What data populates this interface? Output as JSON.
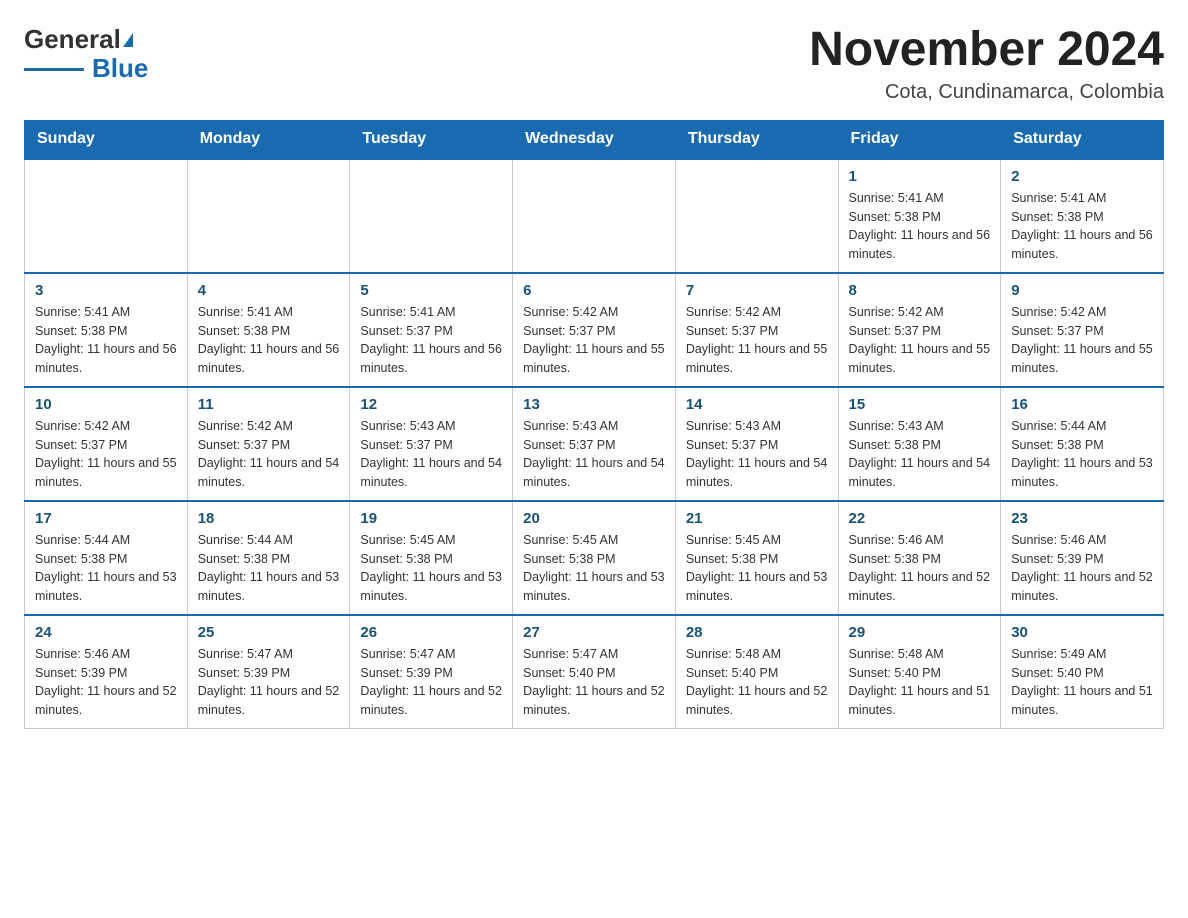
{
  "header": {
    "logo_general": "General",
    "logo_blue": "Blue",
    "month_title": "November 2024",
    "location": "Cota, Cundinamarca, Colombia"
  },
  "weekdays": [
    "Sunday",
    "Monday",
    "Tuesday",
    "Wednesday",
    "Thursday",
    "Friday",
    "Saturday"
  ],
  "weeks": [
    [
      {
        "day": "",
        "info": ""
      },
      {
        "day": "",
        "info": ""
      },
      {
        "day": "",
        "info": ""
      },
      {
        "day": "",
        "info": ""
      },
      {
        "day": "",
        "info": ""
      },
      {
        "day": "1",
        "info": "Sunrise: 5:41 AM\nSunset: 5:38 PM\nDaylight: 11 hours and 56 minutes."
      },
      {
        "day": "2",
        "info": "Sunrise: 5:41 AM\nSunset: 5:38 PM\nDaylight: 11 hours and 56 minutes."
      }
    ],
    [
      {
        "day": "3",
        "info": "Sunrise: 5:41 AM\nSunset: 5:38 PM\nDaylight: 11 hours and 56 minutes."
      },
      {
        "day": "4",
        "info": "Sunrise: 5:41 AM\nSunset: 5:38 PM\nDaylight: 11 hours and 56 minutes."
      },
      {
        "day": "5",
        "info": "Sunrise: 5:41 AM\nSunset: 5:37 PM\nDaylight: 11 hours and 56 minutes."
      },
      {
        "day": "6",
        "info": "Sunrise: 5:42 AM\nSunset: 5:37 PM\nDaylight: 11 hours and 55 minutes."
      },
      {
        "day": "7",
        "info": "Sunrise: 5:42 AM\nSunset: 5:37 PM\nDaylight: 11 hours and 55 minutes."
      },
      {
        "day": "8",
        "info": "Sunrise: 5:42 AM\nSunset: 5:37 PM\nDaylight: 11 hours and 55 minutes."
      },
      {
        "day": "9",
        "info": "Sunrise: 5:42 AM\nSunset: 5:37 PM\nDaylight: 11 hours and 55 minutes."
      }
    ],
    [
      {
        "day": "10",
        "info": "Sunrise: 5:42 AM\nSunset: 5:37 PM\nDaylight: 11 hours and 55 minutes."
      },
      {
        "day": "11",
        "info": "Sunrise: 5:42 AM\nSunset: 5:37 PM\nDaylight: 11 hours and 54 minutes."
      },
      {
        "day": "12",
        "info": "Sunrise: 5:43 AM\nSunset: 5:37 PM\nDaylight: 11 hours and 54 minutes."
      },
      {
        "day": "13",
        "info": "Sunrise: 5:43 AM\nSunset: 5:37 PM\nDaylight: 11 hours and 54 minutes."
      },
      {
        "day": "14",
        "info": "Sunrise: 5:43 AM\nSunset: 5:37 PM\nDaylight: 11 hours and 54 minutes."
      },
      {
        "day": "15",
        "info": "Sunrise: 5:43 AM\nSunset: 5:38 PM\nDaylight: 11 hours and 54 minutes."
      },
      {
        "day": "16",
        "info": "Sunrise: 5:44 AM\nSunset: 5:38 PM\nDaylight: 11 hours and 53 minutes."
      }
    ],
    [
      {
        "day": "17",
        "info": "Sunrise: 5:44 AM\nSunset: 5:38 PM\nDaylight: 11 hours and 53 minutes."
      },
      {
        "day": "18",
        "info": "Sunrise: 5:44 AM\nSunset: 5:38 PM\nDaylight: 11 hours and 53 minutes."
      },
      {
        "day": "19",
        "info": "Sunrise: 5:45 AM\nSunset: 5:38 PM\nDaylight: 11 hours and 53 minutes."
      },
      {
        "day": "20",
        "info": "Sunrise: 5:45 AM\nSunset: 5:38 PM\nDaylight: 11 hours and 53 minutes."
      },
      {
        "day": "21",
        "info": "Sunrise: 5:45 AM\nSunset: 5:38 PM\nDaylight: 11 hours and 53 minutes."
      },
      {
        "day": "22",
        "info": "Sunrise: 5:46 AM\nSunset: 5:38 PM\nDaylight: 11 hours and 52 minutes."
      },
      {
        "day": "23",
        "info": "Sunrise: 5:46 AM\nSunset: 5:39 PM\nDaylight: 11 hours and 52 minutes."
      }
    ],
    [
      {
        "day": "24",
        "info": "Sunrise: 5:46 AM\nSunset: 5:39 PM\nDaylight: 11 hours and 52 minutes."
      },
      {
        "day": "25",
        "info": "Sunrise: 5:47 AM\nSunset: 5:39 PM\nDaylight: 11 hours and 52 minutes."
      },
      {
        "day": "26",
        "info": "Sunrise: 5:47 AM\nSunset: 5:39 PM\nDaylight: 11 hours and 52 minutes."
      },
      {
        "day": "27",
        "info": "Sunrise: 5:47 AM\nSunset: 5:40 PM\nDaylight: 11 hours and 52 minutes."
      },
      {
        "day": "28",
        "info": "Sunrise: 5:48 AM\nSunset: 5:40 PM\nDaylight: 11 hours and 52 minutes."
      },
      {
        "day": "29",
        "info": "Sunrise: 5:48 AM\nSunset: 5:40 PM\nDaylight: 11 hours and 51 minutes."
      },
      {
        "day": "30",
        "info": "Sunrise: 5:49 AM\nSunset: 5:40 PM\nDaylight: 11 hours and 51 minutes."
      }
    ]
  ]
}
